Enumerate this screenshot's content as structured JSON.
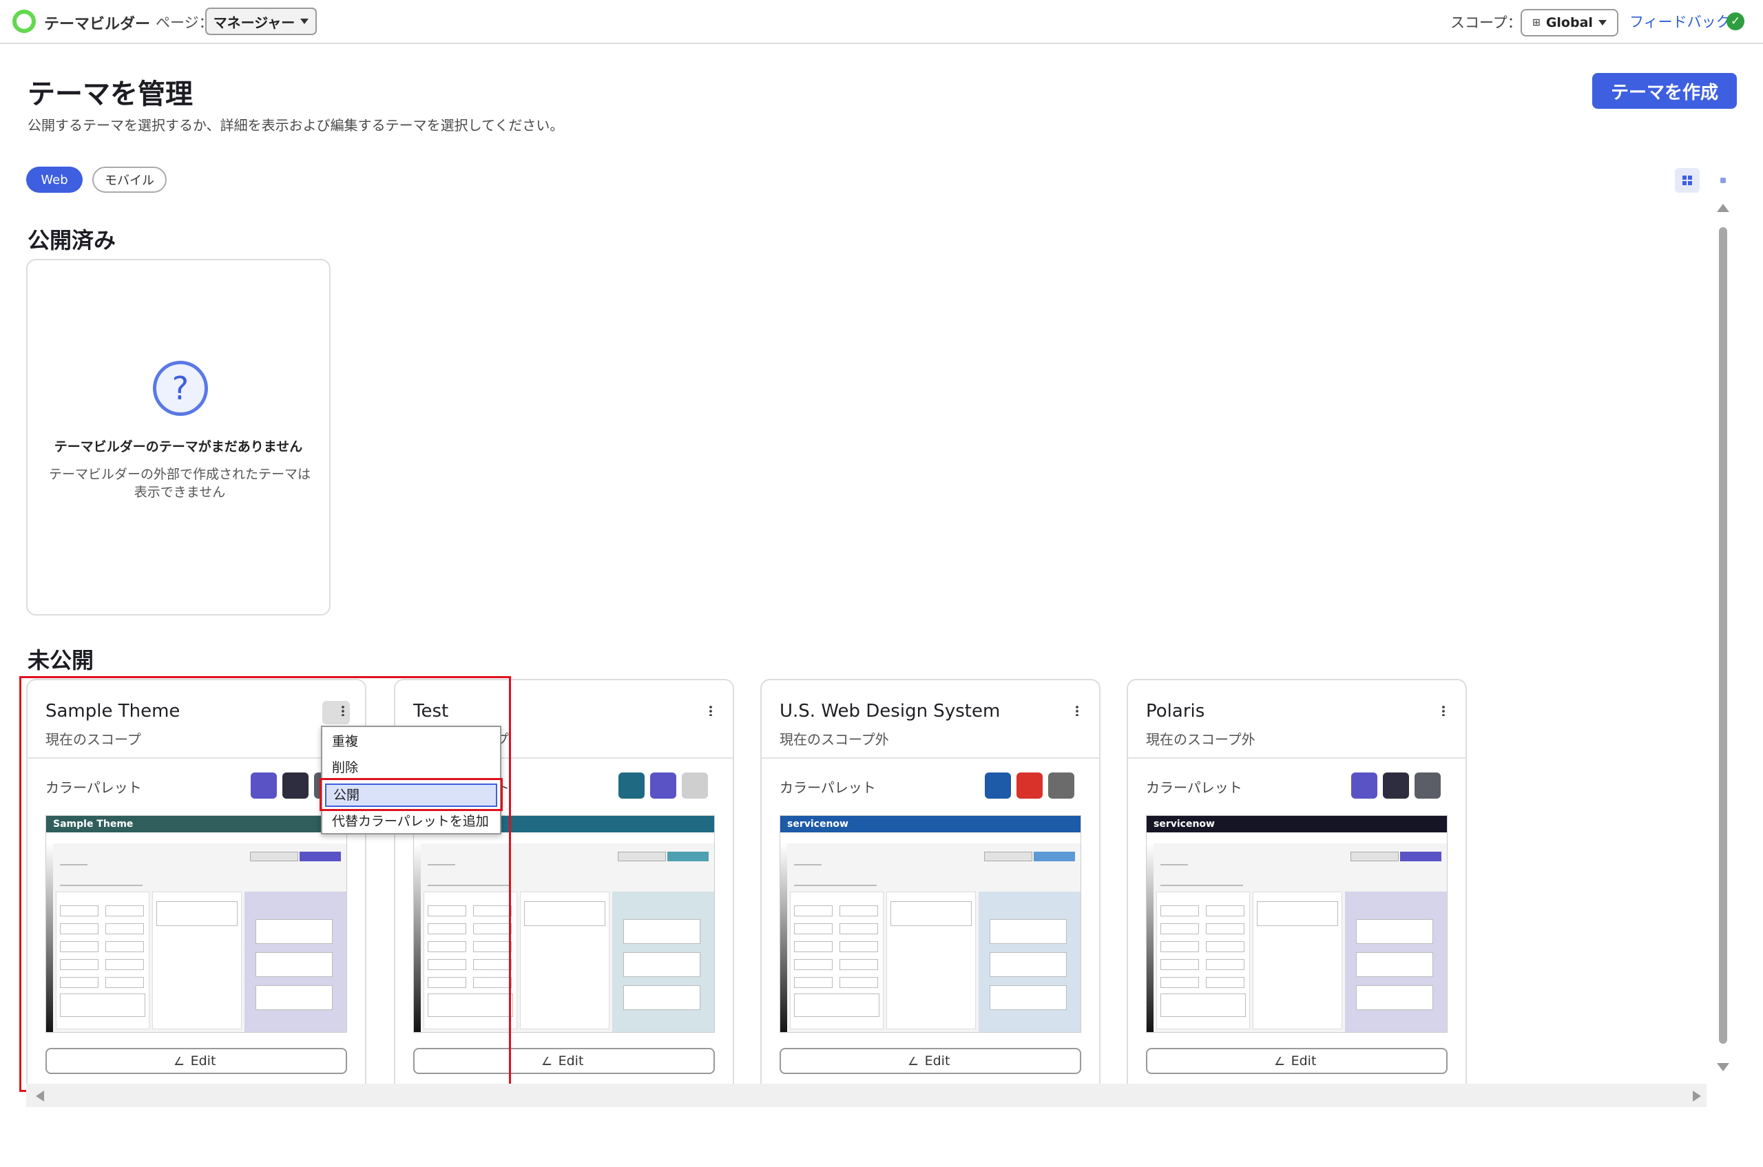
{
  "topbar": {
    "app_name": "テーマビルダー",
    "page_label": "ページ：",
    "page_value": "マネージャー",
    "scope_label": "スコープ：",
    "scope_value": "Global",
    "feedback": "フィードバック",
    "check_glyph": "✓"
  },
  "header": {
    "title": "テーマを管理",
    "subtitle": "公開するテーマを選択するか、詳細を表示および編集するテーマを選択してください。",
    "create_button": "テーマを作成"
  },
  "filters": {
    "web": "Web",
    "mobile": "モバイル"
  },
  "published": {
    "heading": "公開済み",
    "empty_glyph": "?",
    "empty_title": "テーマビルダーのテーマがまだありません",
    "empty_desc": "テーマビルダーの外部で作成されたテーマは表示できません"
  },
  "unpublished": {
    "heading": "未公開",
    "palette_label": "カラーパレット",
    "edit_label": "Edit",
    "cards": [
      {
        "name": "Sample Theme",
        "scope": "現在のスコープ",
        "colors": [
          "#5a53c6",
          "#2e2d3f",
          "#5b5e66"
        ],
        "preview_logo": "Sample Theme",
        "header_color": "#2f5e5c",
        "accent": "#5a53c6"
      },
      {
        "name": "Test",
        "scope": "現在のスコープ",
        "colors": [
          "#1f6a82",
          "#5a53c6",
          "#cfcfcf"
        ],
        "preview_logo": "",
        "header_color": "#1f6a82",
        "accent": "#4f9fb3"
      },
      {
        "name": "U.S. Web Design System",
        "scope": "現在のスコープ外",
        "colors": [
          "#1d5aa8",
          "#d9322b",
          "#6b6b6b"
        ],
        "preview_logo": "servicenow",
        "header_color": "#1d5aa8",
        "accent": "#5b9ad6"
      },
      {
        "name": "Polaris",
        "scope": "現在のスコープ外",
        "colors": [
          "#5a53c6",
          "#2e2d3f",
          "#5b5e66"
        ],
        "preview_logo": "servicenow",
        "header_color": "#161526",
        "accent": "#5a53c6"
      }
    ]
  },
  "context_menu": {
    "items": [
      "重複",
      "削除",
      "公開",
      "代替カラーパレットを追加"
    ]
  }
}
